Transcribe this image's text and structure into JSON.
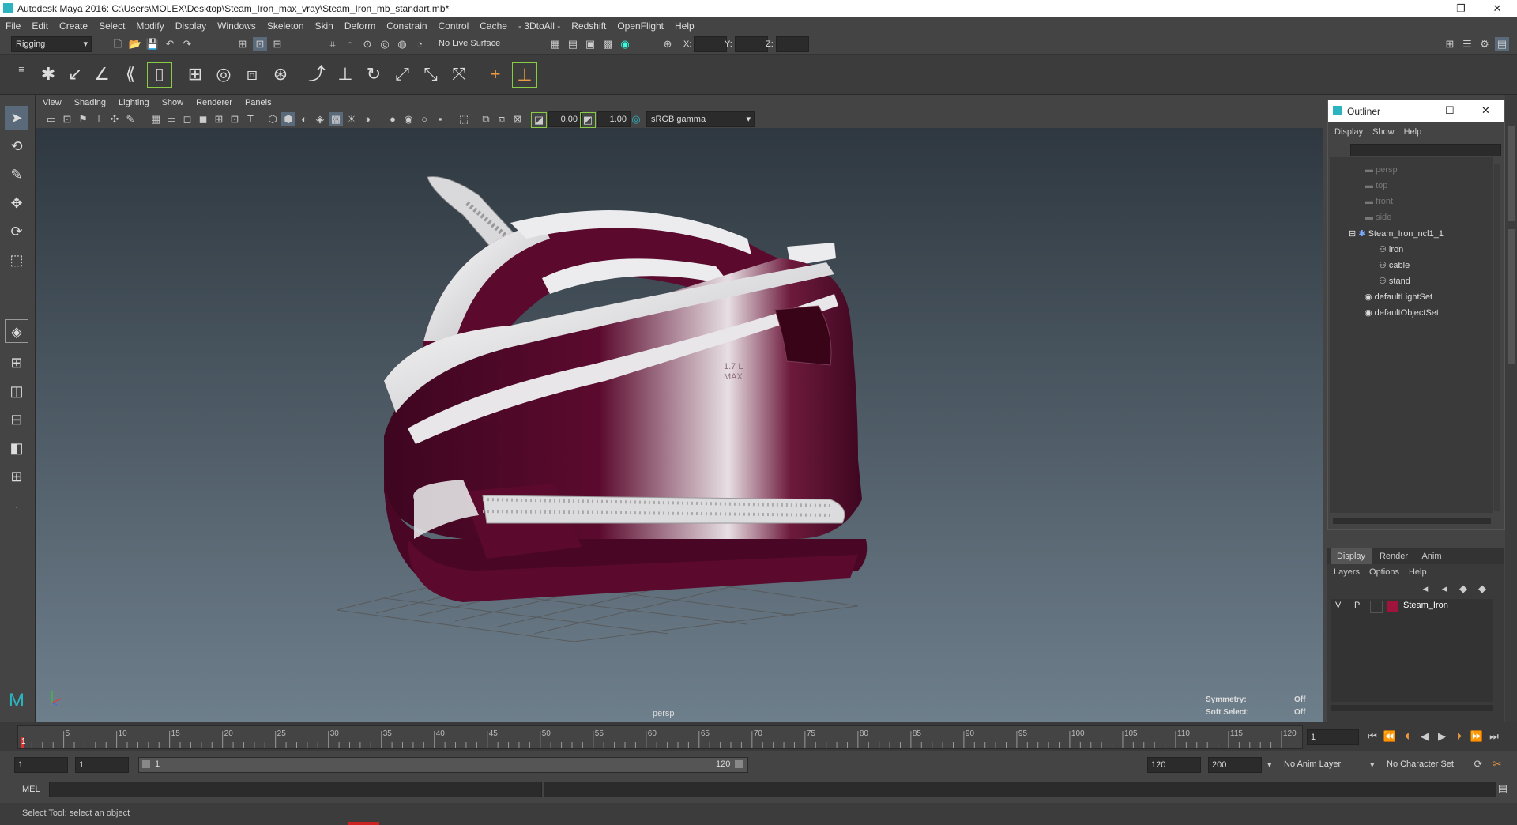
{
  "title_bar": {
    "title": "Autodesk Maya 2016: C:\\Users\\MOLEX\\Desktop\\Steam_Iron_max_vray\\Steam_Iron_mb_standart.mb*"
  },
  "menus": [
    "File",
    "Edit",
    "Create",
    "Select",
    "Modify",
    "Display",
    "Windows",
    "Skeleton",
    "Skin",
    "Deform",
    "Constrain",
    "Control",
    "Cache",
    "- 3DtoAll -",
    "Redshift",
    "OpenFlight",
    "Help"
  ],
  "status": {
    "mode": "Rigging",
    "live_surface": "No Live Surface",
    "x_label": "X:",
    "y_label": "Y:",
    "z_label": "Z:"
  },
  "panel_menu": [
    "View",
    "Shading",
    "Lighting",
    "Show",
    "Renderer",
    "Panels"
  ],
  "panel_tools": {
    "exposure": "0.00",
    "gamma": "1.00",
    "color_space": "sRGB gamma"
  },
  "viewport": {
    "camera_label": "persp",
    "symmetry_label": "Symmetry:",
    "symmetry_value": "Off",
    "soft_select_label": "Soft Select:",
    "soft_select_value": "Off",
    "vol_text_1": "1.7 L",
    "vol_text_2": "MAX"
  },
  "outliner": {
    "title": "Outliner",
    "menu": [
      "Display",
      "Show",
      "Help"
    ],
    "items": [
      "persp",
      "top",
      "front",
      "side",
      "Steam_Iron_ncl1_1",
      "iron",
      "cable",
      "stand",
      "defaultLightSet",
      "defaultObjectSet"
    ]
  },
  "layers": {
    "tabs": [
      "Display",
      "Render",
      "Anim"
    ],
    "menu": [
      "Layers",
      "Options",
      "Help"
    ],
    "layer": {
      "v": "V",
      "p": "P",
      "name": "Steam_Iron",
      "color": "#a0143c"
    }
  },
  "timeline": {
    "ticks": [
      "1",
      "5",
      "10",
      "15",
      "20",
      "25",
      "30",
      "35",
      "40",
      "45",
      "50",
      "55",
      "60",
      "65",
      "70",
      "75",
      "80",
      "85",
      "90",
      "95",
      "100",
      "105",
      "110",
      "115",
      "120"
    ],
    "current_frame": "1"
  },
  "range": {
    "start": "1",
    "start_inner": "1",
    "slider_start": "1",
    "slider_end": "120",
    "end": "120",
    "end_outer": "200",
    "anim_layer": "No Anim Layer",
    "char_set": "No Character Set"
  },
  "command": {
    "lang": "MEL"
  },
  "help_line": "Select Tool: select an object",
  "colors": {
    "iron_body": "#5b0a2e",
    "accent": "#2bb3c0"
  }
}
